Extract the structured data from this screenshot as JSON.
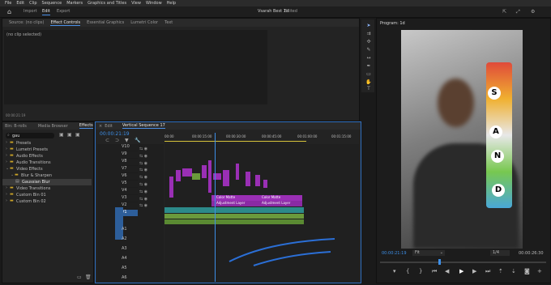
{
  "menu": [
    "File",
    "Edit",
    "Clip",
    "Sequence",
    "Markers",
    "Graphics and Titles",
    "View",
    "Window",
    "Help"
  ],
  "workspace": {
    "home": "⌂",
    "tabs": [
      "Import",
      "Edit",
      "Export"
    ],
    "active": "Edit",
    "project": "Vsarah Best 1d",
    "edited": "Edited"
  },
  "source_panel": {
    "tabs": [
      "Source: (no clips)",
      "Effect Controls",
      "Essential Graphics",
      "Lumetri Color",
      "Text"
    ],
    "active": "Effect Controls",
    "message": "(no clip selected)",
    "time": "00:00:21:19"
  },
  "effects_panel": {
    "tabs": [
      "Bin: B-rolls",
      "Media Browser",
      "Effects"
    ],
    "active": "Effects",
    "search": "gau",
    "items": [
      {
        "label": "Presets",
        "indent": 0
      },
      {
        "label": "Lumetri Presets",
        "indent": 0
      },
      {
        "label": "Audio Effects",
        "indent": 0
      },
      {
        "label": "Audio Transitions",
        "indent": 0
      },
      {
        "label": "Video Effects",
        "indent": 0
      },
      {
        "label": "Blur & Sharpen",
        "indent": 1
      },
      {
        "label": "Gaussian Blur",
        "indent": 2,
        "selected": true
      },
      {
        "label": "Video Transitions",
        "indent": 0
      },
      {
        "label": "Custom Bin 01",
        "indent": 0
      },
      {
        "label": "Custom Bin 02",
        "indent": 0
      }
    ]
  },
  "timeline": {
    "tabs": [
      "Edit",
      "Vertical Sequence 17"
    ],
    "timecode": "00:00:21:19",
    "ruler": [
      "00:00",
      "00:00:15:00",
      "00:00:30:00",
      "00:00:45:00",
      "00:01:00:00",
      "00:01:15:00"
    ],
    "video_tracks": [
      "V10",
      "V9",
      "V8",
      "V7",
      "V6",
      "V5",
      "V4",
      "V3",
      "V2",
      "V1"
    ],
    "audio_tracks": [
      "A1",
      "A2",
      "A3",
      "A4",
      "A5",
      "A6"
    ],
    "clip_labels": [
      "Color Matte",
      "Color Matte",
      "Adjustment Layer",
      "Adjustment Layer"
    ]
  },
  "program": {
    "title": "Program: 1d",
    "timecode": "00:00:21:19",
    "fit": "Fit",
    "resolution": "1/4",
    "duration": "00:00:26:30",
    "letters": [
      "S",
      "A",
      "N",
      "D"
    ]
  },
  "colors": {
    "accent": "#3d8fe8",
    "purple": "#9a2fb5",
    "green": "#6a9a3c",
    "teal": "#2c8a8a"
  }
}
